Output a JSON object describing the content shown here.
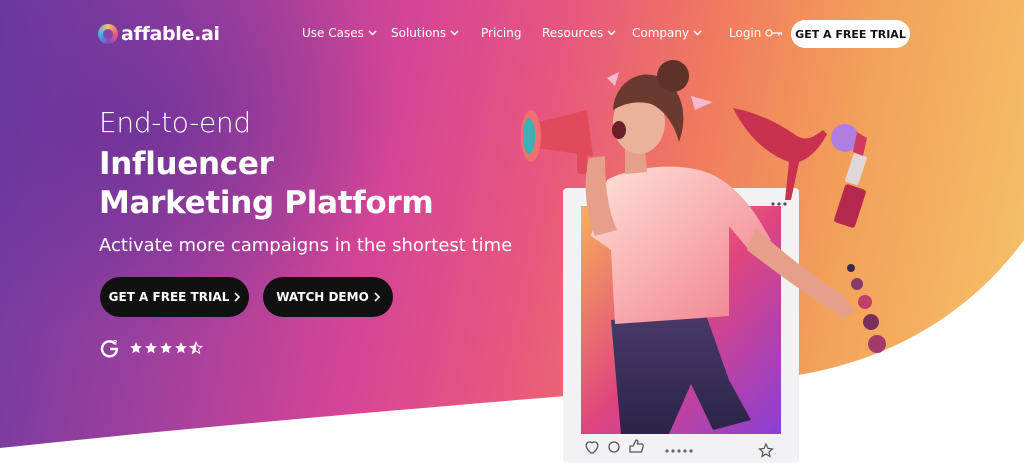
{
  "brand": {
    "logo_text": "affable.ai"
  },
  "nav": {
    "items": [
      {
        "label": "Use Cases",
        "dropdown": true
      },
      {
        "label": "Solutions",
        "dropdown": true
      },
      {
        "label": "Pricing",
        "dropdown": false
      },
      {
        "label": "Resources",
        "dropdown": true
      },
      {
        "label": "Company",
        "dropdown": true
      }
    ],
    "login_label": "Login",
    "trial_label": "GET A FREE TRIAL"
  },
  "hero": {
    "pre_title": "End-to-end",
    "title_line1": "Influencer",
    "title_line2": "Marketing Platform",
    "subtitle": "Activate more campaigns in the shortest time",
    "cta_trial": "GET A FREE TRIAL",
    "cta_demo": "WATCH DEMO",
    "rating": {
      "stars": 4.5,
      "max": 5,
      "badge": "G2"
    }
  },
  "icons": {
    "nav_chevron": "chevron-down-icon",
    "login": "key-icon",
    "cta_arrow": "chevron-right-icon",
    "rating_badge": "g2-logo-icon",
    "post_actions": [
      "heart-icon",
      "comment-icon",
      "thumbs-up-icon",
      "pagination-dots-icon",
      "star-icon"
    ]
  },
  "colors": {
    "gradient": [
      "#6a3aa0",
      "#d64595",
      "#f07c5e",
      "#f4c36a"
    ],
    "cta_bg": "#111111",
    "nav_button_bg": "#ffffff",
    "text": "#ffffff"
  }
}
